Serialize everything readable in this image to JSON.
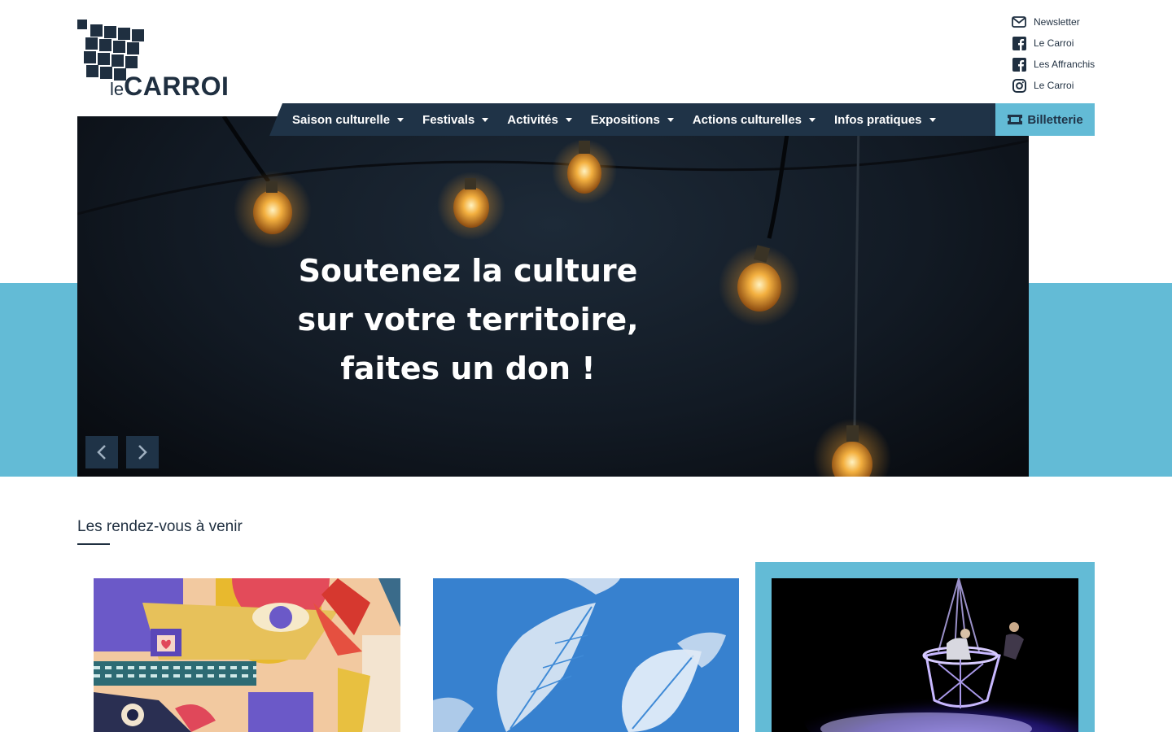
{
  "logo": {
    "le": "le",
    "name": "CARROI"
  },
  "social": [
    {
      "icon": "envelope-icon",
      "label": "Newsletter"
    },
    {
      "icon": "facebook-icon",
      "label": "Le Carroi"
    },
    {
      "icon": "facebook-icon",
      "label": "Les Affranchis"
    },
    {
      "icon": "instagram-icon",
      "label": "Le Carroi"
    }
  ],
  "nav": {
    "items": [
      {
        "label": "Saison culturelle"
      },
      {
        "label": "Festivals"
      },
      {
        "label": "Activités"
      },
      {
        "label": "Expositions"
      },
      {
        "label": "Actions culturelles"
      },
      {
        "label": "Infos pratiques"
      }
    ],
    "ticket_label": "Billetterie"
  },
  "hero": {
    "lines": [
      "Soutenez la culture",
      "sur votre territoire,",
      "faites un don !"
    ]
  },
  "section": {
    "title": "Les rendez-vous à venir"
  },
  "colors": {
    "navy": "#1f3347",
    "accent": "#63bbd6"
  }
}
